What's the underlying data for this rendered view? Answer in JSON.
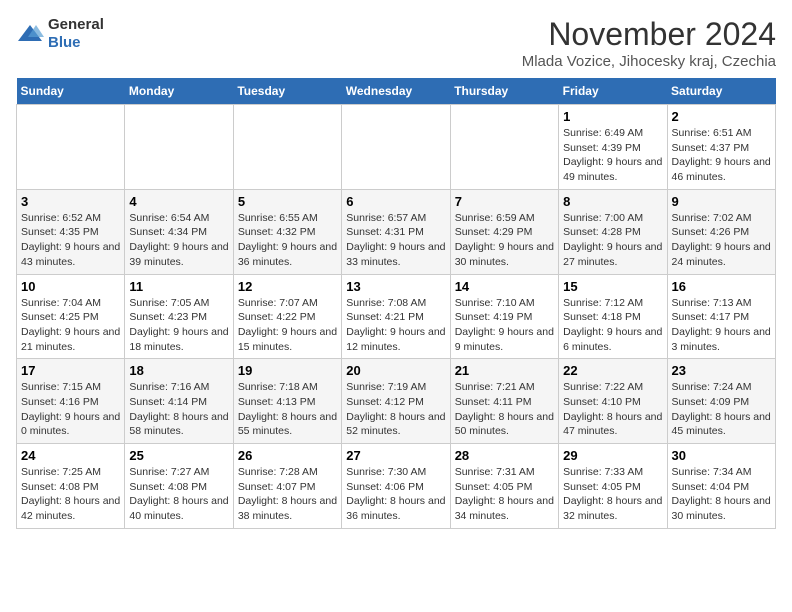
{
  "header": {
    "logo_general": "General",
    "logo_blue": "Blue",
    "title": "November 2024",
    "subtitle": "Mlada Vozice, Jihocesky kraj, Czechia"
  },
  "calendar": {
    "days_of_week": [
      "Sunday",
      "Monday",
      "Tuesday",
      "Wednesday",
      "Thursday",
      "Friday",
      "Saturday"
    ],
    "weeks": [
      [
        {
          "day": "",
          "info": ""
        },
        {
          "day": "",
          "info": ""
        },
        {
          "day": "",
          "info": ""
        },
        {
          "day": "",
          "info": ""
        },
        {
          "day": "",
          "info": ""
        },
        {
          "day": "1",
          "info": "Sunrise: 6:49 AM\nSunset: 4:39 PM\nDaylight: 9 hours and 49 minutes."
        },
        {
          "day": "2",
          "info": "Sunrise: 6:51 AM\nSunset: 4:37 PM\nDaylight: 9 hours and 46 minutes."
        }
      ],
      [
        {
          "day": "3",
          "info": "Sunrise: 6:52 AM\nSunset: 4:35 PM\nDaylight: 9 hours and 43 minutes."
        },
        {
          "day": "4",
          "info": "Sunrise: 6:54 AM\nSunset: 4:34 PM\nDaylight: 9 hours and 39 minutes."
        },
        {
          "day": "5",
          "info": "Sunrise: 6:55 AM\nSunset: 4:32 PM\nDaylight: 9 hours and 36 minutes."
        },
        {
          "day": "6",
          "info": "Sunrise: 6:57 AM\nSunset: 4:31 PM\nDaylight: 9 hours and 33 minutes."
        },
        {
          "day": "7",
          "info": "Sunrise: 6:59 AM\nSunset: 4:29 PM\nDaylight: 9 hours and 30 minutes."
        },
        {
          "day": "8",
          "info": "Sunrise: 7:00 AM\nSunset: 4:28 PM\nDaylight: 9 hours and 27 minutes."
        },
        {
          "day": "9",
          "info": "Sunrise: 7:02 AM\nSunset: 4:26 PM\nDaylight: 9 hours and 24 minutes."
        }
      ],
      [
        {
          "day": "10",
          "info": "Sunrise: 7:04 AM\nSunset: 4:25 PM\nDaylight: 9 hours and 21 minutes."
        },
        {
          "day": "11",
          "info": "Sunrise: 7:05 AM\nSunset: 4:23 PM\nDaylight: 9 hours and 18 minutes."
        },
        {
          "day": "12",
          "info": "Sunrise: 7:07 AM\nSunset: 4:22 PM\nDaylight: 9 hours and 15 minutes."
        },
        {
          "day": "13",
          "info": "Sunrise: 7:08 AM\nSunset: 4:21 PM\nDaylight: 9 hours and 12 minutes."
        },
        {
          "day": "14",
          "info": "Sunrise: 7:10 AM\nSunset: 4:19 PM\nDaylight: 9 hours and 9 minutes."
        },
        {
          "day": "15",
          "info": "Sunrise: 7:12 AM\nSunset: 4:18 PM\nDaylight: 9 hours and 6 minutes."
        },
        {
          "day": "16",
          "info": "Sunrise: 7:13 AM\nSunset: 4:17 PM\nDaylight: 9 hours and 3 minutes."
        }
      ],
      [
        {
          "day": "17",
          "info": "Sunrise: 7:15 AM\nSunset: 4:16 PM\nDaylight: 9 hours and 0 minutes."
        },
        {
          "day": "18",
          "info": "Sunrise: 7:16 AM\nSunset: 4:14 PM\nDaylight: 8 hours and 58 minutes."
        },
        {
          "day": "19",
          "info": "Sunrise: 7:18 AM\nSunset: 4:13 PM\nDaylight: 8 hours and 55 minutes."
        },
        {
          "day": "20",
          "info": "Sunrise: 7:19 AM\nSunset: 4:12 PM\nDaylight: 8 hours and 52 minutes."
        },
        {
          "day": "21",
          "info": "Sunrise: 7:21 AM\nSunset: 4:11 PM\nDaylight: 8 hours and 50 minutes."
        },
        {
          "day": "22",
          "info": "Sunrise: 7:22 AM\nSunset: 4:10 PM\nDaylight: 8 hours and 47 minutes."
        },
        {
          "day": "23",
          "info": "Sunrise: 7:24 AM\nSunset: 4:09 PM\nDaylight: 8 hours and 45 minutes."
        }
      ],
      [
        {
          "day": "24",
          "info": "Sunrise: 7:25 AM\nSunset: 4:08 PM\nDaylight: 8 hours and 42 minutes."
        },
        {
          "day": "25",
          "info": "Sunrise: 7:27 AM\nSunset: 4:08 PM\nDaylight: 8 hours and 40 minutes."
        },
        {
          "day": "26",
          "info": "Sunrise: 7:28 AM\nSunset: 4:07 PM\nDaylight: 8 hours and 38 minutes."
        },
        {
          "day": "27",
          "info": "Sunrise: 7:30 AM\nSunset: 4:06 PM\nDaylight: 8 hours and 36 minutes."
        },
        {
          "day": "28",
          "info": "Sunrise: 7:31 AM\nSunset: 4:05 PM\nDaylight: 8 hours and 34 minutes."
        },
        {
          "day": "29",
          "info": "Sunrise: 7:33 AM\nSunset: 4:05 PM\nDaylight: 8 hours and 32 minutes."
        },
        {
          "day": "30",
          "info": "Sunrise: 7:34 AM\nSunset: 4:04 PM\nDaylight: 8 hours and 30 minutes."
        }
      ]
    ]
  }
}
